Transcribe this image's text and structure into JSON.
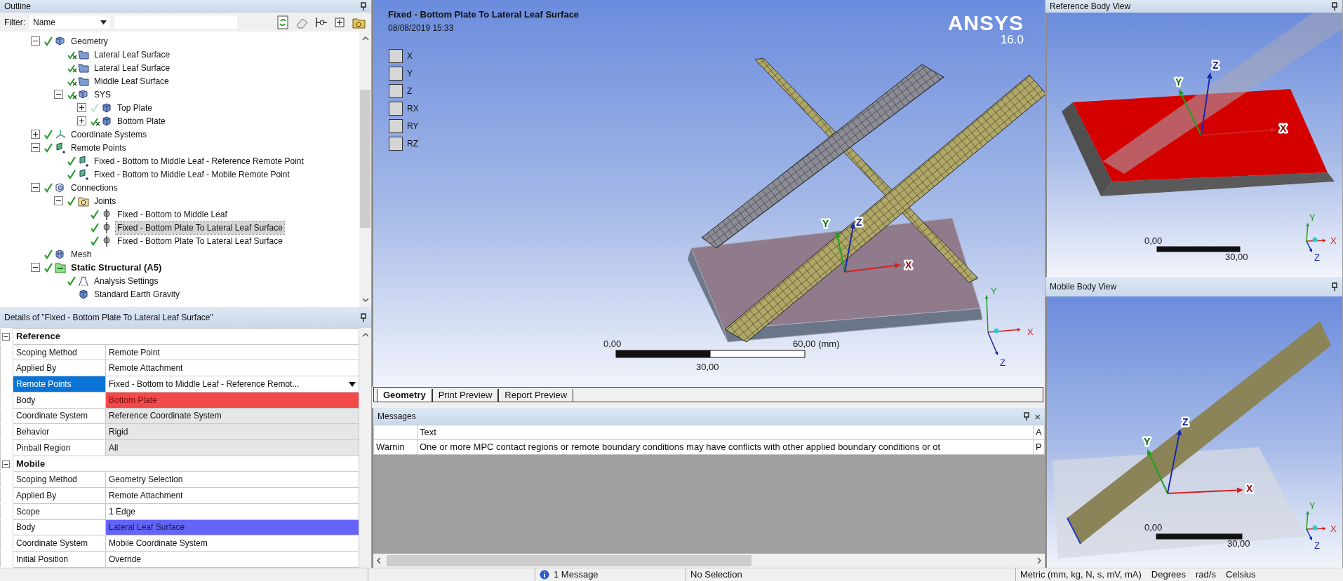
{
  "outline": {
    "title": "Outline",
    "filter": {
      "label": "Filter:",
      "field": "Name"
    },
    "tree": [
      {
        "label": "Geometry",
        "kind": "geometry",
        "hidden": false,
        "faded": false,
        "expanded": true,
        "selected": false,
        "children": [
          {
            "label": "Lateral Leaf Surface",
            "kind": "surface",
            "hidden": true,
            "faded": false,
            "selected": false
          },
          {
            "label": "Lateral Leaf Surface",
            "kind": "surface",
            "hidden": true,
            "faded": false,
            "selected": false
          },
          {
            "label": "Middle Leaf Surface",
            "kind": "surface",
            "hidden": true,
            "faded": false,
            "selected": false
          },
          {
            "label": "SYS",
            "kind": "geometry",
            "hidden": true,
            "faded": false,
            "expanded": true,
            "selected": false,
            "children": [
              {
                "label": "Top Plate",
                "kind": "part",
                "hidden": false,
                "faded": true,
                "expanded": false,
                "selected": false
              },
              {
                "label": "Bottom Plate",
                "kind": "part",
                "hidden": true,
                "faded": false,
                "expanded": false,
                "selected": false
              }
            ]
          }
        ]
      },
      {
        "label": "Coordinate Systems",
        "kind": "coords",
        "hidden": false,
        "faded": false,
        "expanded": false,
        "selected": false
      },
      {
        "label": "Remote Points",
        "kind": "remote",
        "hidden": false,
        "faded": false,
        "expanded": true,
        "selected": false,
        "children": [
          {
            "label": "Fixed - Bottom to Middle Leaf - Reference Remote Point",
            "kind": "remote",
            "hidden": false,
            "faded": false,
            "selected": false
          },
          {
            "label": "Fixed - Bottom to Middle Leaf - Mobile Remote Point",
            "kind": "remote",
            "hidden": false,
            "faded": false,
            "selected": false
          }
        ]
      },
      {
        "label": "Connections",
        "kind": "connections",
        "hidden": false,
        "faded": false,
        "expanded": true,
        "selected": false,
        "children": [
          {
            "label": "Joints",
            "kind": "joints",
            "hidden": false,
            "faded": false,
            "expanded": true,
            "selected": false,
            "children": [
              {
                "label": "Fixed - Bottom to Middle Leaf",
                "kind": "joint",
                "hidden": false,
                "faded": false,
                "selected": false
              },
              {
                "label": "Fixed - Bottom Plate To Lateral Leaf Surface",
                "kind": "joint",
                "hidden": false,
                "faded": false,
                "selected": true
              },
              {
                "label": "Fixed - Bottom Plate To Lateral Leaf Surface",
                "kind": "joint",
                "hidden": false,
                "faded": false,
                "selected": false
              }
            ]
          }
        ]
      },
      {
        "label": "Mesh",
        "kind": "mesh",
        "hidden": false,
        "faded": false,
        "selected": false
      },
      {
        "label": "Static Structural (A5)",
        "kind": "analysis",
        "hidden": false,
        "faded": false,
        "expanded": true,
        "selected": false,
        "children": [
          {
            "label": "Analysis Settings",
            "kind": "settings",
            "hidden": false,
            "faded": false,
            "selected": false
          },
          {
            "label": "Standard Earth Gravity",
            "kind": "part",
            "selected": false
          }
        ]
      }
    ]
  },
  "details": {
    "title": "Details of \"Fixed - Bottom Plate To Lateral Leaf Surface\"",
    "groups": [
      {
        "label": "Reference",
        "expanded": true,
        "rows": [
          {
            "label": "Scoping Method",
            "value": "Remote Point",
            "kind": "text",
            "readonly": false,
            "selected": false
          },
          {
            "label": "Applied By",
            "value": "Remote Attachment",
            "kind": "text",
            "readonly": false,
            "selected": false
          },
          {
            "label": "Remote Points",
            "value": "Fixed - Bottom to Middle Leaf - Reference Remot...",
            "kind": "dropdown",
            "readonly": false,
            "selected": true
          },
          {
            "label": "Body",
            "value": "Bottom Plate",
            "kind": "text",
            "readonly": false,
            "selected": false,
            "color": "#f24a4a"
          },
          {
            "label": "Coordinate System",
            "value": "Reference Coordinate System",
            "kind": "text",
            "readonly": true,
            "selected": false
          },
          {
            "label": "Behavior",
            "value": "Rigid",
            "kind": "text",
            "readonly": true,
            "selected": false
          },
          {
            "label": "Pinball Region",
            "value": "All",
            "kind": "text",
            "readonly": true,
            "selected": false
          }
        ]
      },
      {
        "label": "Mobile",
        "expanded": true,
        "rows": [
          {
            "label": "Scoping Method",
            "value": "Geometry Selection",
            "kind": "text",
            "readonly": false,
            "selected": false
          },
          {
            "label": "Applied By",
            "value": "Remote Attachment",
            "kind": "text",
            "readonly": false,
            "selected": false
          },
          {
            "label": "Scope",
            "value": "1 Edge",
            "kind": "text",
            "readonly": false,
            "selected": false
          },
          {
            "label": "Body",
            "value": "Lateral Leaf Surface",
            "kind": "text",
            "readonly": false,
            "selected": false,
            "color": "#6464f8"
          },
          {
            "label": "Coordinate System",
            "value": "Mobile Coordinate System",
            "kind": "text",
            "readonly": false,
            "selected": false
          },
          {
            "label": "Initial Position",
            "value": "Override",
            "kind": "text",
            "readonly": false,
            "selected": false
          }
        ]
      }
    ]
  },
  "viewport": {
    "title": "Fixed - Bottom Plate To Lateral Leaf Surface",
    "date": "08/08/2019 15:33",
    "dofs": [
      {
        "label": "X",
        "checked": false
      },
      {
        "label": "Y",
        "checked": false
      },
      {
        "label": "Z",
        "checked": false
      },
      {
        "label": "RX",
        "checked": false
      },
      {
        "label": "RY",
        "checked": false
      },
      {
        "label": "RZ",
        "checked": false
      }
    ],
    "logo": {
      "name": "ANSYS",
      "version": "16.0"
    },
    "model_axes": {
      "x": "X",
      "y": "Y",
      "z": "Z"
    },
    "corner_axes": {
      "x": "X",
      "y": "Y",
      "z": "Z"
    },
    "scale": {
      "start": "0,00",
      "mid": "30,00",
      "end": "60,00 (mm)"
    }
  },
  "view_tabs": [
    {
      "label": "Geometry",
      "selected": true
    },
    {
      "label": "Print Preview",
      "selected": false
    },
    {
      "label": "Report Preview",
      "selected": false
    }
  ],
  "messages": {
    "title": "Messages",
    "close": "×",
    "columns": [
      "",
      "Text",
      "A"
    ],
    "rows": [
      [
        "Warnin",
        "One or more MPC contact regions or remote boundary conditions may have conflicts with other applied boundary conditions or ot",
        "P"
      ]
    ]
  },
  "reference_view": {
    "title": "Reference Body View",
    "model_axes": {
      "x": "X",
      "y": "Y",
      "z": "Z"
    },
    "corner_axes": {
      "x": "X",
      "y": "Y",
      "z": "Z"
    },
    "scale": {
      "start": "0,00",
      "end": "30,00"
    }
  },
  "mobile_view": {
    "title": "Mobile Body View",
    "model_axes": {
      "x": "X",
      "y": "Y",
      "z": "Z"
    },
    "corner_axes": {
      "x": "X",
      "y": "Y",
      "z": "Z"
    },
    "scale": {
      "start": "0,00",
      "end": "30,00"
    }
  },
  "status_bar": {
    "messages": "1 Message",
    "selection": "No Selection",
    "units": [
      "Metric (mm, kg, N, s, mV, mA)",
      "Degrees",
      "rad/s",
      "Celsius"
    ]
  }
}
